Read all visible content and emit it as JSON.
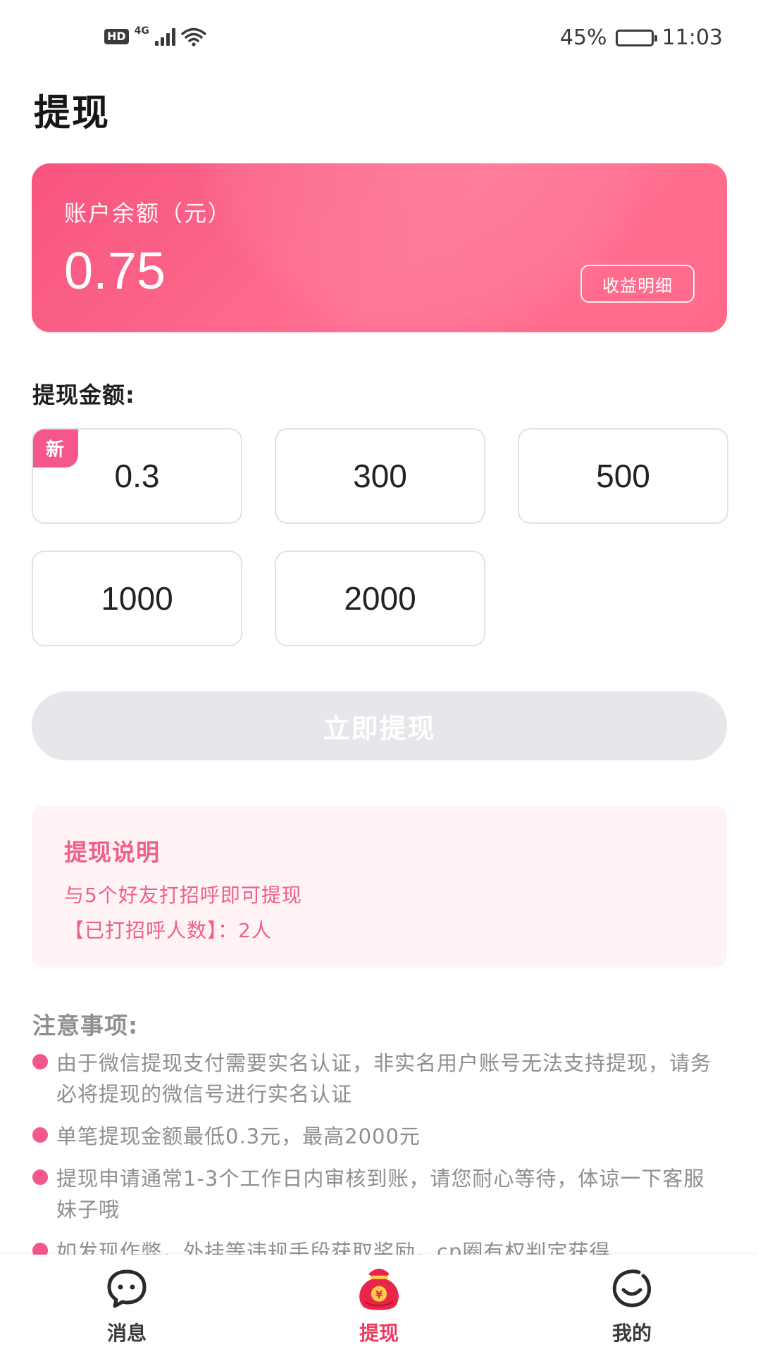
{
  "status_bar": {
    "hd": "HD",
    "network": "4G",
    "battery_percent": "45%",
    "battery_level": 0.45,
    "time": "11:03"
  },
  "page_title": "提现",
  "balance": {
    "label": "账户余额（元）",
    "value": "0.75",
    "detail_button": "收益明细"
  },
  "amount_section": {
    "label": "提现金额:",
    "new_badge": "新",
    "options": [
      "0.3",
      "300",
      "500",
      "1000",
      "2000"
    ]
  },
  "withdraw_button": "立即提现",
  "explanation": {
    "title": "提现说明",
    "line1": "与5个好友打招呼即可提现",
    "line2": "【已打招呼人数】：2人"
  },
  "notes": {
    "title": "注意事项:",
    "items": [
      "由于微信提现支付需要实名认证，非实名用户账号无法支持提现，请务必将提现的微信号进行实名认证",
      "单笔提现金额最低0.3元，最高2000元",
      "提现申请通常1-3个工作日内审核到账，请您耐心等待，体谅一下客服妹子哦",
      "如发现作弊，外挂等违规手段获取奖励，cp圈有权判定获得"
    ]
  },
  "nav": {
    "messages": "消息",
    "withdraw": "提现",
    "mine": "我的",
    "currency_symbol": "¥"
  },
  "colors": {
    "accent": "#f5578a",
    "nav_active": "#ec3b5f",
    "card_gradient_start": "#f7547e",
    "card_gradient_end": "#ff6a8c",
    "disabled_button": "#e6e7ea"
  }
}
